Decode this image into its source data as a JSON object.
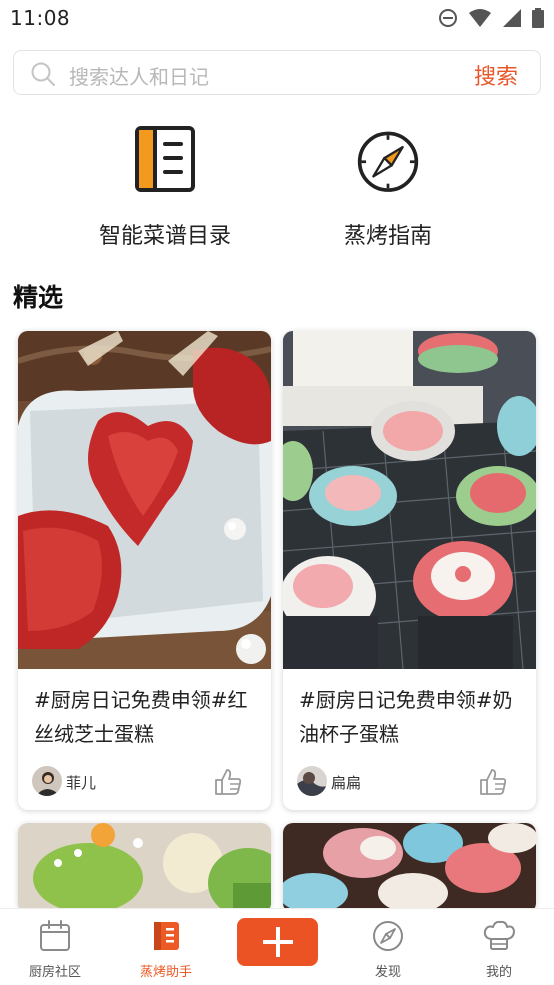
{
  "status_bar": {
    "time": "11:08",
    "icons": [
      "do-not-disturb-icon",
      "wifi-icon",
      "cellular-signal-icon",
      "battery-icon"
    ]
  },
  "search": {
    "placeholder": "搜索达人和日记",
    "button_label": "搜索",
    "icon": "search-icon"
  },
  "quick_entries": [
    {
      "label": "智能菜谱目录",
      "icon": "recipe-book-icon"
    },
    {
      "label": "蒸烤指南",
      "icon": "compass-icon"
    }
  ],
  "section": {
    "title": "精选"
  },
  "cards": [
    {
      "title": "#厨房日记免费申领#红丝绒芝士蛋糕",
      "author": "菲儿",
      "image": "red-velvet-heart-cakes-photo"
    },
    {
      "title": "#厨房日记免费申领#奶油杯子蛋糕",
      "author": "扁扁",
      "image": "cream-cupcakes-photo"
    },
    {
      "title": "",
      "author": "",
      "image": "green-cupcakes-photo"
    },
    {
      "title": "",
      "author": "",
      "image": "flower-cupcakes-photo"
    }
  ],
  "bottom_nav": {
    "items": [
      {
        "label": "厨房社区",
        "icon": "calendar-icon",
        "active": false
      },
      {
        "label": "蒸烤助手",
        "icon": "book-icon",
        "active": true
      },
      {
        "label": "发现",
        "icon": "compass-icon",
        "active": false
      },
      {
        "label": "我的",
        "icon": "chef-hat-icon",
        "active": false
      }
    ],
    "add_icon": "plus-icon"
  },
  "colors": {
    "accent": "#ec5324",
    "accent_text": "#e8572a",
    "book_orange": "#f39a1e",
    "text": "#222222",
    "muted": "#b8b8b8"
  }
}
